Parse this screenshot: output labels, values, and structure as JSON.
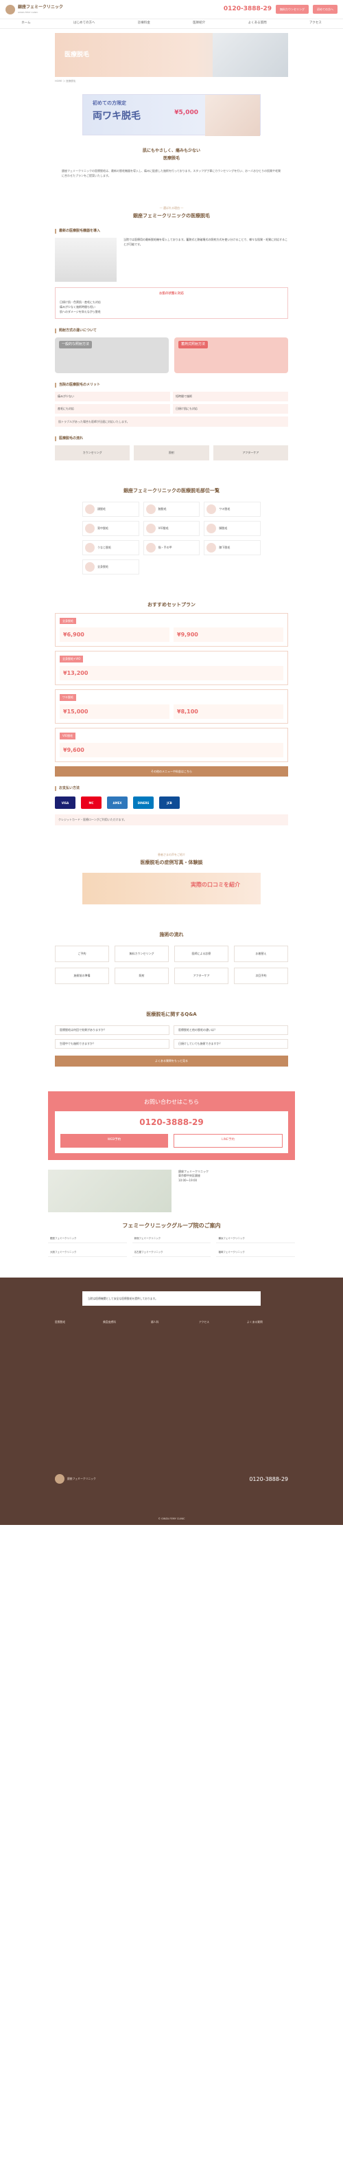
{
  "header": {
    "logo": "銀座フェミークリニック",
    "logo_sub": "GINZA FEMY CLINIC",
    "tel": "0120-3888-29",
    "btn1": "無料カウンセリング",
    "btn2": "初めての方へ"
  },
  "nav": [
    "ホーム",
    "はじめての方へ",
    "診療料金",
    "医師紹介",
    "よくある質問",
    "アクセス"
  ],
  "hero": {
    "title": "医療脱毛"
  },
  "crumb": "HOME ＞ 医療脱毛",
  "banner": {
    "small": "初めての方限定",
    "big": "両ワキ脱毛",
    "price": "¥5,000"
  },
  "intro": {
    "h1": "肌にもやさしく、痛みも少ない",
    "h2": "医療脱毛",
    "p": "銀座フェミークリニックの医療脱毛は、最新の脱毛機器を導入し、痛みに配慮した施術を行っております。スタッフが丁寧にカウンセリングを行い、お一人おひとりの肌質や毛質に合わせたプランをご提案いたします。"
  },
  "s1": {
    "label": "― 選ばれる理由 ―",
    "title": "銀座フェミークリニックの医療脱毛",
    "sub1": "最新の医療脱毛機器を導入",
    "machine": "当院では医療用の最新脱毛機を導入しております。蓄熱式と熱破壊式の照射方式を使い分けることで、様々な肌質・毛質に対応することが可能です。",
    "box_h": "お肌の状態に対応",
    "box": [
      "日焼け肌・色黒肌・産毛にも対応",
      "痛みが少なく施術時間も短い",
      "肌へのダメージを抑えながら脱毛"
    ],
    "sub2": "照射方式の違いについて",
    "cmp_a": "一般的な照射方法",
    "cmp_b": "蓄熱式照射方法",
    "sub3": "当院の医療脱毛のメリット",
    "grid": [
      "痛みが少ない",
      "短時間で施術",
      "産毛にも対応",
      "日焼け肌にも対応"
    ],
    "note": "肌トラブルがあった場合も医師が迅速に対応いたします。",
    "sub4": "医療脱毛の流れ",
    "flow": [
      "カウンセリング",
      "照射",
      "アフターケア"
    ]
  },
  "s2": {
    "title": "銀座フェミークリニックの医療脱毛部位一覧",
    "parts": [
      "顔脱毛",
      "腕脱毛",
      "ワキ脱毛",
      "背中脱毛",
      "VIO脱毛",
      "脚脱毛",
      "うなじ脱毛",
      "指・手の甲",
      "膝下脱毛",
      "全身脱毛"
    ]
  },
  "s3": {
    "title": "おすすめセットプラン",
    "plans": [
      {
        "h": "全身脱毛",
        "a": "¥6,900",
        "b": "¥9,900"
      },
      {
        "h": "全身脱毛+VIO",
        "a": "¥13,200"
      },
      {
        "h": "ワキ脱毛",
        "a": "¥15,000",
        "b": "¥8,100"
      },
      {
        "h": "VIO脱毛",
        "a": "¥9,600"
      }
    ],
    "btn": "その他のメニューや料金はこちら"
  },
  "s4": {
    "sub": "お支払い方法",
    "cards": [
      "VISA",
      "MC",
      "AMEX",
      "DINERS",
      "JCB"
    ],
    "note": "クレジットカード・医療ローンがご利用いただけます。"
  },
  "s5": {
    "label": "患者さまの声をご紹介",
    "title": "医療脱毛の症例写真・体験談",
    "review": "実際の口コミを紹介"
  },
  "s6": {
    "title": "施術の流れ",
    "flow": [
      "ご予約",
      "無料カウンセリング",
      "医師による診察",
      "お着替え",
      "施術前の準備",
      "照射",
      "アフターケア",
      "次回予約"
    ]
  },
  "s7": {
    "title": "医療脱毛に関するQ&A",
    "faq": [
      "医療脱毛は何回で効果がありますか？",
      "医療脱毛と他の脱毛の違いは？",
      "生理中でも施術できますか？",
      "日焼けしていても施術できますか？"
    ],
    "btn": "よくある質問をもっと見る"
  },
  "contact": {
    "h": "お問い合わせはこちら",
    "tel": "0120-3888-29",
    "btn1": "WEB予約",
    "btn2": "LINE予約"
  },
  "access": {
    "name": "銀座フェミークリニック",
    "addr": "東京都中央区銀座",
    "hours": "10:00〜19:00"
  },
  "group": {
    "h": "フェミークリニックグループ院のご案内",
    "items": [
      "銀座フェミークリニック",
      "新宿フェミークリニック",
      "横浜フェミークリニック",
      "大阪フェミークリニック",
      "名古屋フェミークリニック",
      "福岡フェミークリニック"
    ]
  },
  "footer": {
    "box": "当院は医療機関として安全な医療脱毛を提供しております。",
    "cols": [
      "医療脱毛",
      "美容皮膚科",
      "婦人科",
      "アクセス",
      "よくある質問"
    ],
    "tel": "0120-3888-29",
    "copy": "© GINZA FEMY CLINIC"
  }
}
